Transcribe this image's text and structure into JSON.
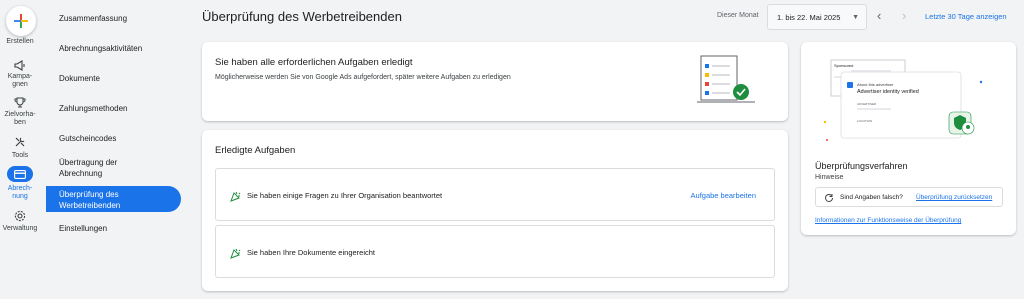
{
  "rail": {
    "create_label": "Erstellen",
    "items": [
      {
        "label": "Kampa-\ngnen",
        "icon": "megaphone-icon"
      },
      {
        "label": "Zielvorha-\nben",
        "icon": "trophy-icon"
      },
      {
        "label": "Tools",
        "icon": "tools-icon"
      },
      {
        "label": "Abrech-\nnung",
        "icon": "credit-card-icon"
      },
      {
        "label": "Verwaltung",
        "icon": "settings-icon"
      }
    ]
  },
  "subnav": {
    "items": [
      "Zusammenfassung",
      "Abrechnungsaktivitäten",
      "Dokumente",
      "Zahlungsmethoden",
      "Gutscheincodes",
      "Übertragung der Abrechnung",
      "Überprüfung des Werbetreibenden",
      "Einstellungen"
    ]
  },
  "header": {
    "title": "Überprüfung des Werbetreibenden",
    "month_label": "Dieser Monat",
    "date_range": "1. bis 22. Mai 2025",
    "last30": "Letzte 30 Tage anzeigen"
  },
  "done_card": {
    "title": "Sie haben alle erforderlichen Aufgaben erledigt",
    "subtitle": "Möglicherweise werden Sie von Google Ads aufgefordert, später weitere Aufgaben zu erledigen"
  },
  "completed": {
    "title": "Erledigte Aufgaben",
    "tasks": [
      {
        "text": "Sie haben einige Fragen zu Ihrer Organisation beantwortet",
        "link": "Aufgabe bearbeiten"
      },
      {
        "text": "Sie haben Ihre Dokumente eingereicht",
        "link": ""
      }
    ]
  },
  "process": {
    "sponsored": "Sponsored",
    "about": "About this advertiser",
    "verified": "Advertiser identity verified",
    "advertiser_caps": "ADVERTISER",
    "location_caps": "LOCATION",
    "title": "Überprüfungsverfahren",
    "subtitle": "Hinweise",
    "question": "Sind Angaben falsch?",
    "reset_link": "Überprüfung zurücksetzen",
    "info_link": "Informationen zur Funktionsweise der Überprüfung"
  },
  "colors": {
    "accent": "#1a73e8",
    "success": "#1e8e3e"
  }
}
